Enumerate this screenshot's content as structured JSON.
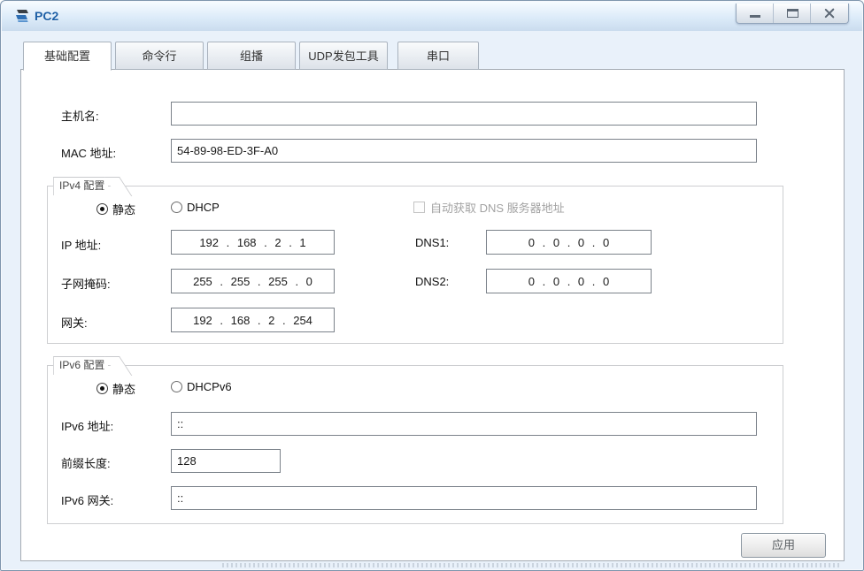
{
  "window": {
    "title": "PC2",
    "controls": {
      "minimize": "minimize",
      "maximize": "maximize",
      "close": "close"
    }
  },
  "icons": {
    "app": "pc-icon",
    "minimize": "minimize-icon",
    "maximize": "maximize-icon",
    "close": "close-icon"
  },
  "tabs": [
    {
      "label": "基础配置",
      "active": true
    },
    {
      "label": "命令行",
      "active": false
    },
    {
      "label": "组播",
      "active": false
    },
    {
      "label": "UDP发包工具",
      "active": false
    },
    {
      "label": "串口",
      "active": false
    }
  ],
  "form": {
    "hostname": {
      "label": "主机名:",
      "value": ""
    },
    "mac": {
      "label": "MAC 地址:",
      "value": "54-89-98-ED-3F-A0"
    },
    "ipv4": {
      "group_label": "IPv4 配置",
      "static_label": "静态",
      "dhcp_label": "DHCP",
      "static_selected": true,
      "dns_auto_label": "自动获取 DNS 服务器地址",
      "dns_auto_checked": false,
      "ip": {
        "label": "IP 地址:",
        "value": "192 . 168 . 2 . 1"
      },
      "mask": {
        "label": "子网掩码:",
        "value": "255 . 255 . 255 . 0"
      },
      "gateway": {
        "label": "网关:",
        "value": "192 . 168 . 2 . 254"
      },
      "dns1": {
        "label": "DNS1:",
        "value": "0 . 0 . 0 . 0"
      },
      "dns2": {
        "label": "DNS2:",
        "value": "0 . 0 . 0 . 0"
      }
    },
    "ipv6": {
      "group_label": "IPv6 配置",
      "static_label": "静态",
      "dhcp_label": "DHCPv6",
      "static_selected": true,
      "address": {
        "label": "IPv6 地址:",
        "value": "::"
      },
      "prefix": {
        "label": "前缀长度:",
        "value": "128"
      },
      "gateway": {
        "label": "IPv6 网关:",
        "value": "::"
      }
    },
    "apply_label": "应用"
  }
}
